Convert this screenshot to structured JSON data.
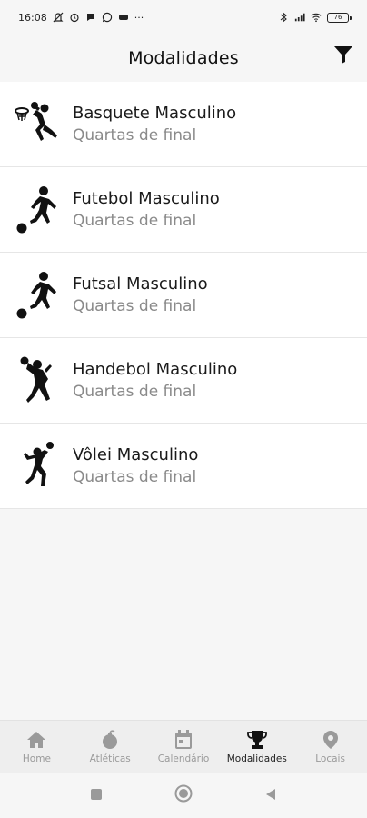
{
  "status_bar": {
    "time": "16:08",
    "more": "···",
    "battery": "76"
  },
  "header": {
    "title": "Modalidades"
  },
  "items": [
    {
      "title": "Basquete Masculino",
      "subtitle": "Quartas de final",
      "icon": "basketball-player-icon"
    },
    {
      "title": "Futebol Masculino",
      "subtitle": "Quartas de final",
      "icon": "soccer-player-icon"
    },
    {
      "title": "Futsal Masculino",
      "subtitle": "Quartas de final",
      "icon": "futsal-player-icon"
    },
    {
      "title": "Handebol Masculino",
      "subtitle": "Quartas de final",
      "icon": "handball-player-icon"
    },
    {
      "title": "Vôlei Masculino",
      "subtitle": "Quartas de final",
      "icon": "volleyball-player-icon"
    }
  ],
  "bottom_nav": [
    {
      "label": "Home",
      "icon": "home-icon",
      "active": false
    },
    {
      "label": "Atléticas",
      "icon": "bomb-icon",
      "active": false
    },
    {
      "label": "Calendário",
      "icon": "calendar-icon",
      "active": false
    },
    {
      "label": "Modalidades",
      "icon": "trophy-icon",
      "active": true
    },
    {
      "label": "Locais",
      "icon": "location-pin-icon",
      "active": false
    }
  ],
  "colors": {
    "background": "#f6f6f6",
    "list_bg": "#ffffff",
    "subtitle": "#8a8a8a",
    "nav_inactive": "#9a9a9a",
    "nav_active": "#222222"
  }
}
